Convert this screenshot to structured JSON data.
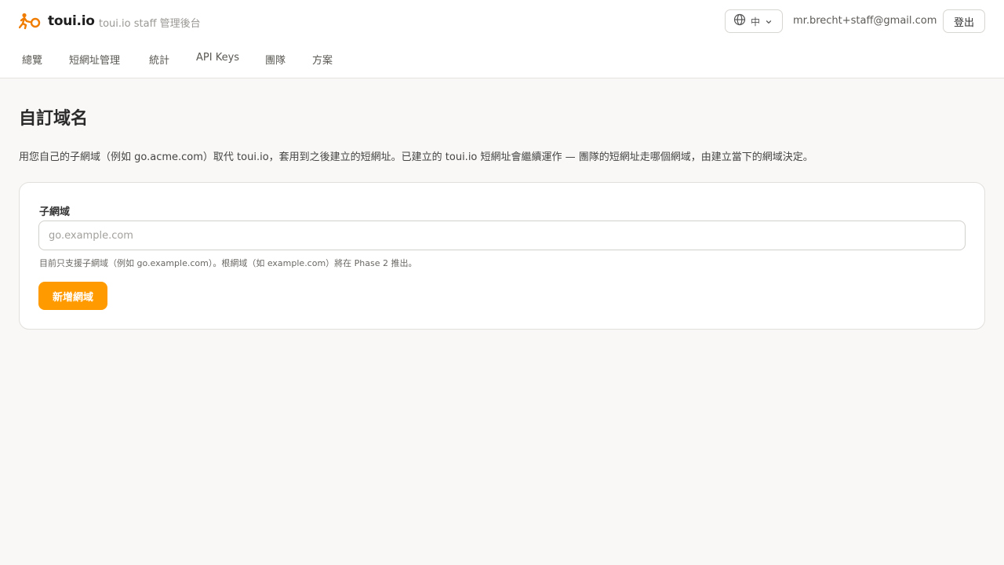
{
  "header": {
    "brand": "toui.io",
    "subtitle": "toui.io staff 管理後台",
    "language": {
      "label": "中",
      "icon": "globe-icon"
    },
    "user_email": "mr.brecht+staff@gmail.com",
    "logout_label": "登出"
  },
  "nav": {
    "items": [
      {
        "label": "總覽"
      },
      {
        "label": "短網址管理"
      },
      {
        "label": "統計"
      },
      {
        "label": "API Keys"
      },
      {
        "label": "團隊"
      },
      {
        "label": "方案"
      }
    ]
  },
  "main": {
    "title": "自訂域名",
    "description": "用您自己的子網域（例如 go.acme.com）取代 toui.io，套用到之後建立的短網址。已建立的 toui.io 短網址會繼續運作 — 團隊的短網址走哪個網域，由建立當下的網域決定。",
    "form": {
      "field_label": "子網域",
      "input_value": "",
      "input_placeholder": "go.example.com",
      "hint": "目前只支援子網域（例如 go.example.com）。根網域（如 example.com）將在 Phase 2 推出。",
      "submit_label": "新增網域"
    }
  },
  "colors": {
    "accent": "#ff9a00",
    "brand_orange": "#f07d00",
    "background": "#f9f8f6"
  }
}
